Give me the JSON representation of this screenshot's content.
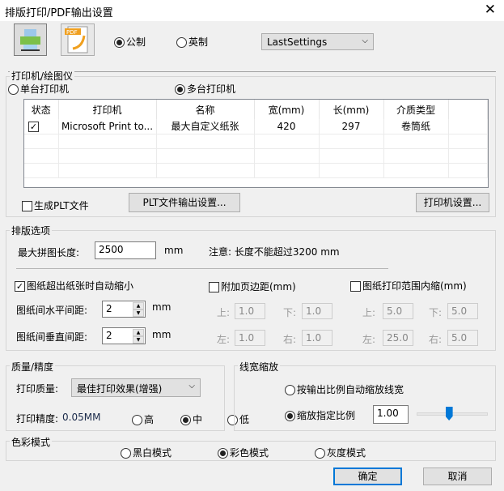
{
  "window": {
    "title": "排版打印/PDF输出设置",
    "close": "✕"
  },
  "toolbar": {
    "units": [
      {
        "label": "公制",
        "selected": true
      },
      {
        "label": "英制",
        "selected": false
      }
    ],
    "preset": "LastSettings",
    "pdf_icon_text": "PDF"
  },
  "printer_group": {
    "title": "打印机/绘图仪",
    "single": "单台打印机",
    "multi": "多台打印机",
    "multi_selected": true,
    "columns": [
      "状态",
      "打印机",
      "名称",
      "宽(mm)",
      "长(mm)",
      "介质类型"
    ],
    "rows": [
      {
        "checked": true,
        "printer": "Microsoft Print to...",
        "name": "最大自定义纸张",
        "width": "420",
        "length": "297",
        "media": "卷筒纸"
      }
    ],
    "gen_plt": "生成PLT文件",
    "plt_settings": "PLT文件输出设置...",
    "printer_settings": "打印机设置..."
  },
  "layout_group": {
    "title": "排版选项",
    "max_len_label": "最大拼图长度:",
    "max_len": "2500",
    "unit": "mm",
    "note": "注意: 长度不能超过3200 mm",
    "auto_shrink": "图纸超出纸张时自动缩小",
    "extra_margin": "附加页边距(mm)",
    "inner_shrink": "图纸打印范围内缩(mm)",
    "h_gap_label": "图纸间水平间距:",
    "h_gap": "2",
    "v_gap_label": "图纸间垂直间距:",
    "v_gap": "2",
    "top": "上:",
    "bottom": "下:",
    "left": "左:",
    "right": "右:",
    "margin": {
      "top": "1.0",
      "bottom": "1.0",
      "left": "1.0",
      "right": "1.0"
    },
    "inner": {
      "top": "5.0",
      "bottom": "5.0",
      "left": "25.0",
      "right": "5.0"
    }
  },
  "quality_group": {
    "title": "质量/精度",
    "quality_label": "打印质量:",
    "quality": "最佳打印效果(增强)",
    "precision_label": "打印精度:",
    "precision": "0.05MM",
    "high": "高",
    "mid": "中",
    "low": "低"
  },
  "linewidth_group": {
    "title": "线宽缩放",
    "auto": "按输出比例自动缩放线宽",
    "fixed": "缩放指定比例",
    "scale": "1.00",
    "slider_fraction": 0.45
  },
  "color_group": {
    "title": "色彩模式",
    "bw": "黑白模式",
    "color": "彩色模式",
    "gray": "灰度模式"
  },
  "buttons": {
    "ok": "确定",
    "cancel": "取消"
  }
}
